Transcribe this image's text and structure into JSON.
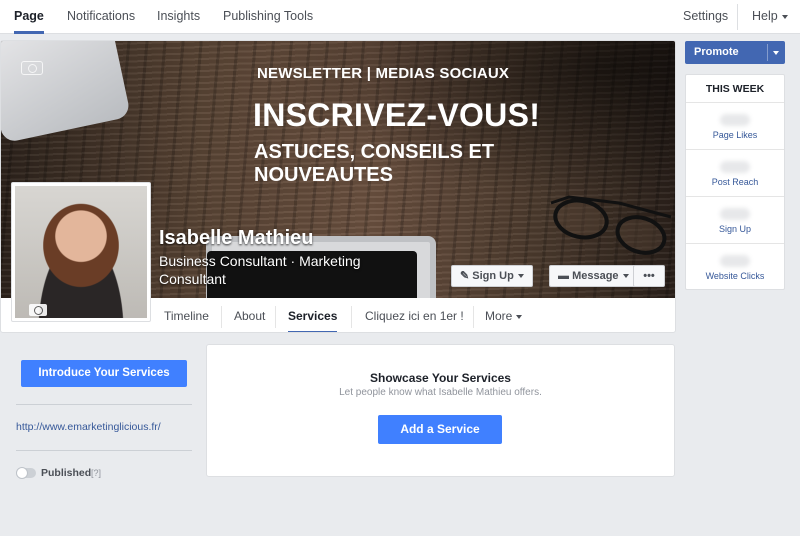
{
  "topnav": {
    "tabs": [
      {
        "label": "Page"
      },
      {
        "label": "Notifications"
      },
      {
        "label": "Insights"
      },
      {
        "label": "Publishing Tools"
      }
    ],
    "settings_label": "Settings",
    "help_label": "Help"
  },
  "cover": {
    "line1": "NEWSLETTER | MEDIAS SOCIAUX",
    "line2": "INSCRIVEZ-VOUS!",
    "line3": "ASTUCES, CONSEILS ET NOUVEAUTES"
  },
  "page": {
    "name": "Isabelle Mathieu",
    "category": "Business Consultant · Marketing Consultant"
  },
  "cover_buttons": {
    "signup_label": "Sign Up",
    "message_label": "Message",
    "more_label": "•••"
  },
  "tabs": [
    {
      "label": "Timeline"
    },
    {
      "label": "About"
    },
    {
      "label": "Services"
    },
    {
      "label": "Cliquez ici en 1er !"
    },
    {
      "label": "More"
    }
  ],
  "right": {
    "promote_label": "Promote",
    "week_title": "THIS WEEK",
    "stats": [
      {
        "label": "Page Likes"
      },
      {
        "label": "Post Reach"
      },
      {
        "label": "Sign Up"
      },
      {
        "label": "Website Clicks"
      }
    ]
  },
  "left": {
    "introduce_label": "Introduce Your Services",
    "website": "http://www.emarketinglicious.fr/",
    "published_label": "Published",
    "help_marker": "[?]"
  },
  "showcase": {
    "title": "Showcase Your Services",
    "subtitle": "Let people know what Isabelle Mathieu offers.",
    "add_label": "Add a Service"
  },
  "colors": {
    "accent_blue": "#4267b2",
    "button_blue": "#4080ff",
    "link_blue": "#365899",
    "page_bg": "#e9ebee"
  }
}
